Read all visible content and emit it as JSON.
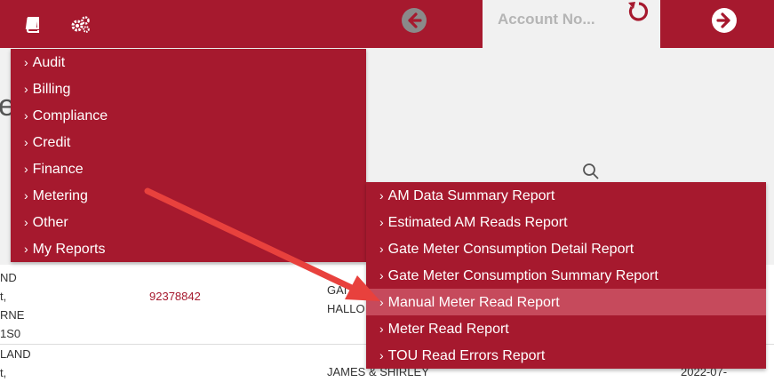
{
  "header": {
    "account_placeholder": "Account No..."
  },
  "colors": {
    "brand": "#a6192e",
    "highlight": "#c64a5c",
    "annotation_arrow": "#e8413d"
  },
  "icons": [
    "book-icon",
    "gears-icon",
    "back-arrow-icon",
    "refresh-icon",
    "forward-arrow-icon",
    "search-icon"
  ],
  "page": {
    "title_fragment": "e"
  },
  "main_menu": {
    "items": [
      {
        "label": "Audit"
      },
      {
        "label": "Billing"
      },
      {
        "label": "Compliance"
      },
      {
        "label": "Credit"
      },
      {
        "label": "Finance"
      },
      {
        "label": "Metering"
      },
      {
        "label": "Other"
      },
      {
        "label": "My Reports"
      }
    ]
  },
  "submenu": {
    "items": [
      {
        "label": "AM Data Summary Report"
      },
      {
        "label": "Estimated AM Reads Report"
      },
      {
        "label": "Gate Meter Consumption Detail Report"
      },
      {
        "label": "Gate Meter Consumption Summary Report"
      },
      {
        "label": "Manual Meter Read Report"
      },
      {
        "label": "Meter Read Report"
      },
      {
        "label": "TOU Read Errors Report"
      }
    ]
  },
  "table": {
    "rows": [
      {
        "address": "ND\nt,\nRNE\n1S0",
        "account": "92378842",
        "name": "GAI\nHALLO"
      },
      {
        "address": "LAND\nt,",
        "account": "",
        "name": "JAMES & SHIRLEY",
        "date": "2022-07-"
      }
    ]
  }
}
